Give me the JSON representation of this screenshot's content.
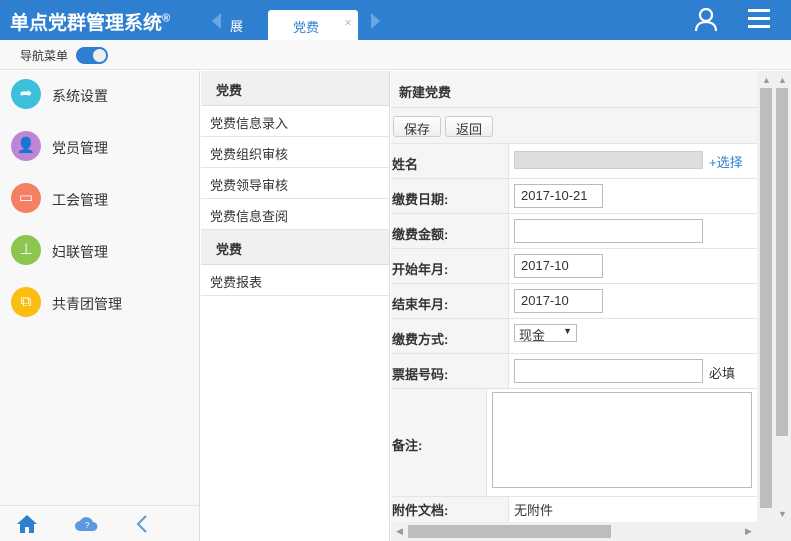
{
  "header": {
    "title": "单点党群管理系统",
    "reg": "®",
    "tabs": [
      {
        "label": "展"
      },
      {
        "label": "党费",
        "close": "×"
      }
    ],
    "user_icon": "user-icon",
    "menu_icon": "hamburger-icon"
  },
  "toolbar": {
    "nav_label": "导航菜单",
    "nav_toggle_on": true
  },
  "sidebar": {
    "items": [
      {
        "label": "系统设置",
        "color": "#3cc0dc",
        "icon": "share-arrow-icon"
      },
      {
        "label": "党员管理",
        "color": "#c185d6",
        "icon": "person-icon"
      },
      {
        "label": "工会管理",
        "color": "#f57f62",
        "icon": "briefcase-icon"
      },
      {
        "label": "妇联管理",
        "color": "#8cc54f",
        "icon": "stamp-icon"
      },
      {
        "label": "共青团管理",
        "color": "#fbbd12",
        "icon": "transfer-icon"
      }
    ],
    "bottom": [
      "home-icon",
      "cloud-icon",
      "chevron-left-icon"
    ]
  },
  "middle": {
    "groups": [
      {
        "title": "党费",
        "items": [
          "党费信息录入",
          "党费组织审核",
          "党费领导审核",
          "党费信息查阅"
        ]
      },
      {
        "title": "党费",
        "items": [
          "党费报表"
        ]
      }
    ]
  },
  "form": {
    "title": "新建党费",
    "save": "保存",
    "back": "返回",
    "fields": {
      "name": {
        "label": "姓名",
        "value": "",
        "select": "+选择"
      },
      "pay_date": {
        "label": "缴费日期:",
        "value": "2017-10-21"
      },
      "amount": {
        "label": "缴费金额:",
        "value": ""
      },
      "start": {
        "label": "开始年月:",
        "value": "2017-10"
      },
      "end": {
        "label": "结束年月:",
        "value": "2017-10"
      },
      "method": {
        "label": "缴费方式:",
        "value": "现金"
      },
      "receipt": {
        "label": "票据号码:",
        "value": "",
        "required": "必填"
      },
      "remark": {
        "label": "备注:",
        "value": ""
      },
      "attach": {
        "label": "附件文档:",
        "value": "无附件"
      }
    }
  }
}
